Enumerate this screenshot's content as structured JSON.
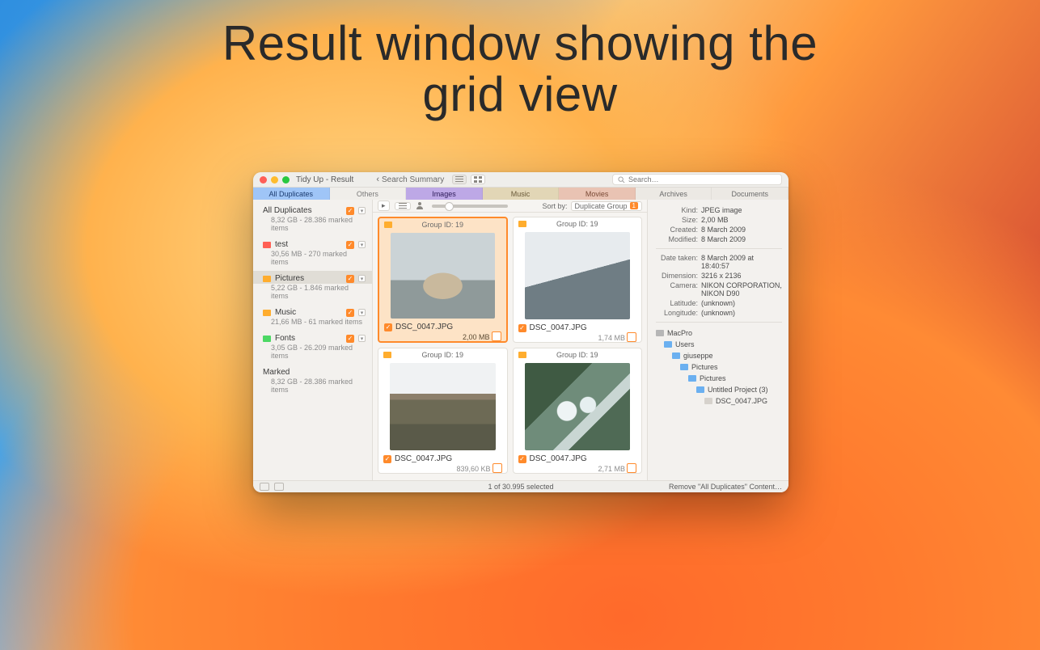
{
  "hero": {
    "line1": "Result window showing the",
    "line2": "grid view"
  },
  "window": {
    "title": "Tidy Up - Result",
    "back_label": "Search Summary",
    "search_placeholder": "Search…"
  },
  "tabs": {
    "all_duplicates": "All Duplicates",
    "others": "Others",
    "images": "Images",
    "music": "Music",
    "movies": "Movies",
    "archives": "Archives",
    "documents": "Documents"
  },
  "sidebar": {
    "items": [
      {
        "name": "All Duplicates",
        "meta": "8,32 GB - 28.386 marked items",
        "color": null,
        "selected": false
      },
      {
        "name": "test",
        "meta": "30,56 MB - 270 marked items",
        "color": "red",
        "selected": false
      },
      {
        "name": "Pictures",
        "meta": "5,22 GB - 1.846 marked items",
        "color": "orange",
        "selected": true
      },
      {
        "name": "Music",
        "meta": "21,66 MB - 61 marked items",
        "color": "orange",
        "selected": false
      },
      {
        "name": "Fonts",
        "meta": "3,05 GB - 26.209 marked items",
        "color": "green",
        "selected": false
      },
      {
        "name": "Marked",
        "meta": "8,32 GB - 28.386 marked items",
        "color": null,
        "selected": false
      }
    ]
  },
  "toolbar": {
    "sort_label": "Sort by:",
    "sort_value": "Duplicate Group",
    "sort_badge": "1"
  },
  "cards": [
    {
      "group": "Group ID: 19",
      "file": "DSC_0047.JPG",
      "size": "2,00 MB",
      "thumb": "t1",
      "selected": true
    },
    {
      "group": "Group ID: 19",
      "file": "DSC_0047.JPG",
      "size": "1,74 MB",
      "thumb": "t2",
      "selected": false
    },
    {
      "group": "Group ID: 19",
      "file": "DSC_0047.JPG",
      "size": "839,60 KB",
      "thumb": "t3",
      "selected": false
    },
    {
      "group": "Group ID: 19",
      "file": "DSC_0047.JPG",
      "size": "2,71 MB",
      "thumb": "t4",
      "selected": false
    }
  ],
  "info": {
    "kind_k": "Kind:",
    "kind_v": "JPEG image",
    "size_k": "Size:",
    "size_v": "2,00 MB",
    "created_k": "Created:",
    "created_v": "8 March 2009",
    "modified_k": "Modified:",
    "modified_v": "8 March 2009",
    "taken_k": "Date taken:",
    "taken_v": "8 March 2009 at 18:40:57",
    "dim_k": "Dimension:",
    "dim_v": "3216 x 2136",
    "cam_k": "Camera:",
    "cam_v": "NIKON CORPORATION, NIKON D90",
    "lat_k": "Latitude:",
    "lat_v": "(unknown)",
    "lon_k": "Longitude:",
    "lon_v": "(unknown)"
  },
  "tree": {
    "n0": "MacPro",
    "n1": "Users",
    "n2": "giuseppe",
    "n3": "Pictures",
    "n4": "Pictures",
    "n5": "Untitled Project (3)",
    "n6": "DSC_0047.JPG"
  },
  "status": {
    "center": "1 of 30.995 selected",
    "right": "Remove \"All Duplicates\" Content…"
  }
}
